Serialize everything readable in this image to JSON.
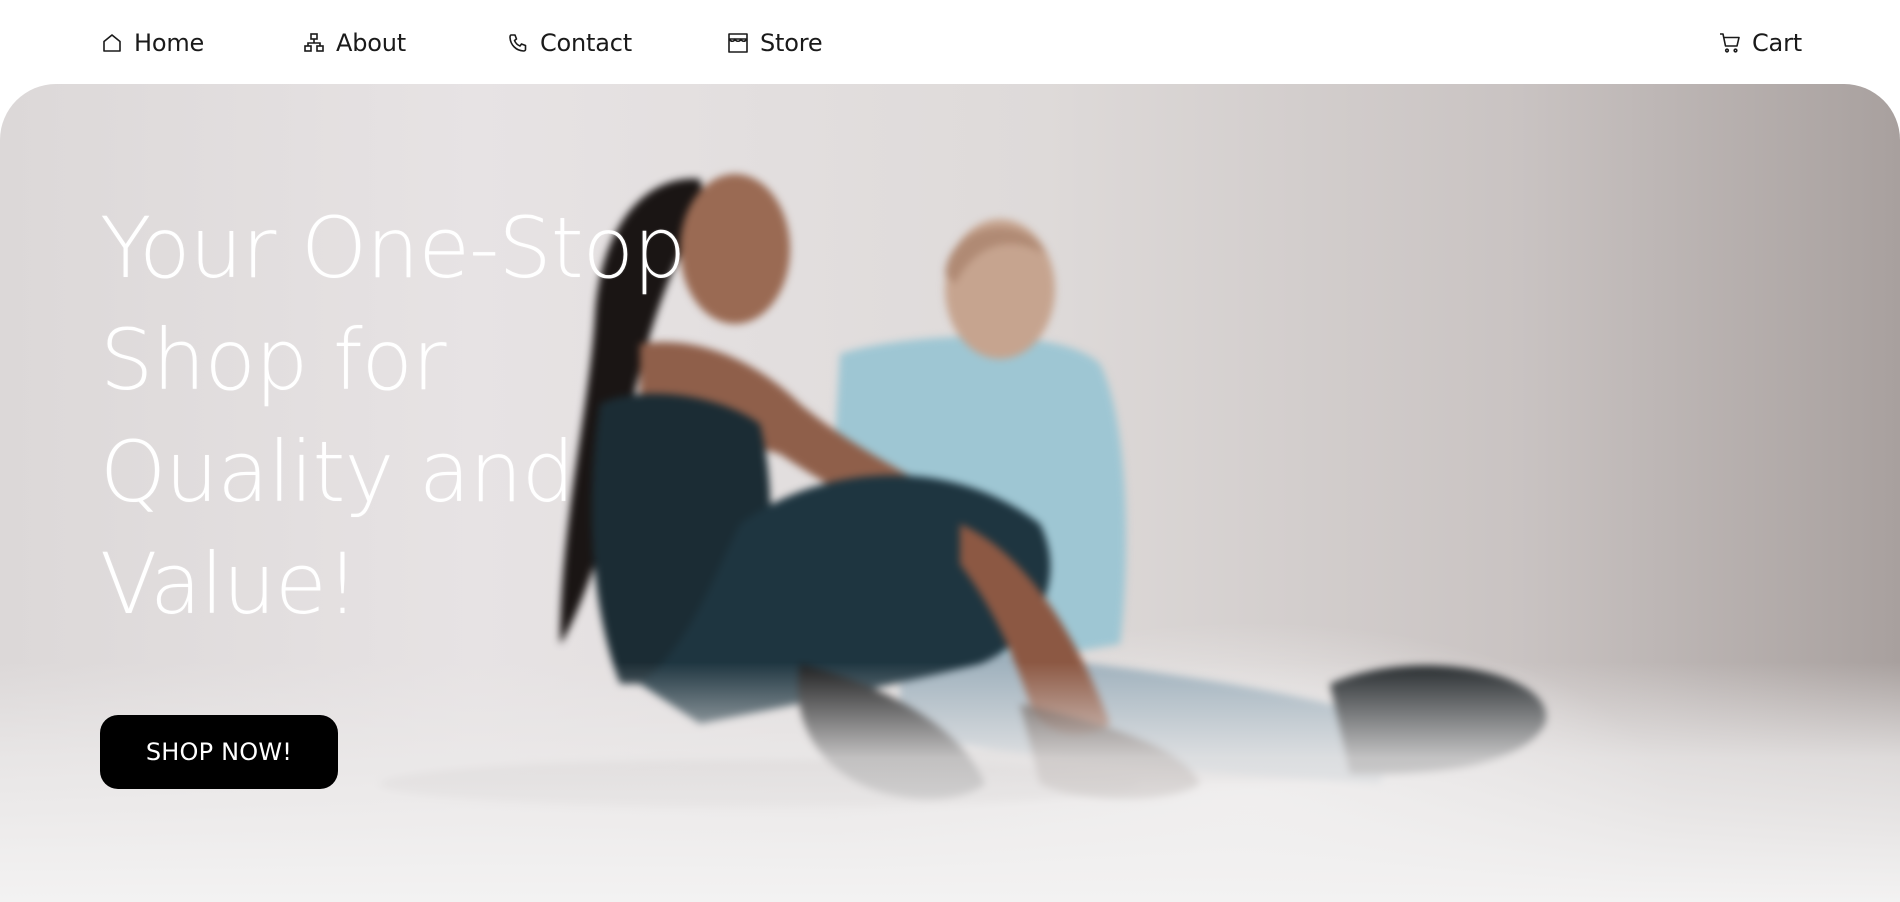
{
  "nav": {
    "items": [
      {
        "label": "Home",
        "icon": "home-icon"
      },
      {
        "label": "About",
        "icon": "sitemap-icon"
      },
      {
        "label": "Contact",
        "icon": "phone-icon"
      },
      {
        "label": "Store",
        "icon": "store-icon"
      }
    ],
    "cart": {
      "label": "Cart",
      "icon": "cart-icon"
    }
  },
  "hero": {
    "title": "Your One-Stop Shop for Quality and Value!",
    "cta_label": "SHOP NOW!"
  },
  "colors": {
    "nav_text": "#1a1a1a",
    "button_bg": "#000000",
    "button_text": "#ffffff",
    "hero_text": "#ffffff"
  }
}
